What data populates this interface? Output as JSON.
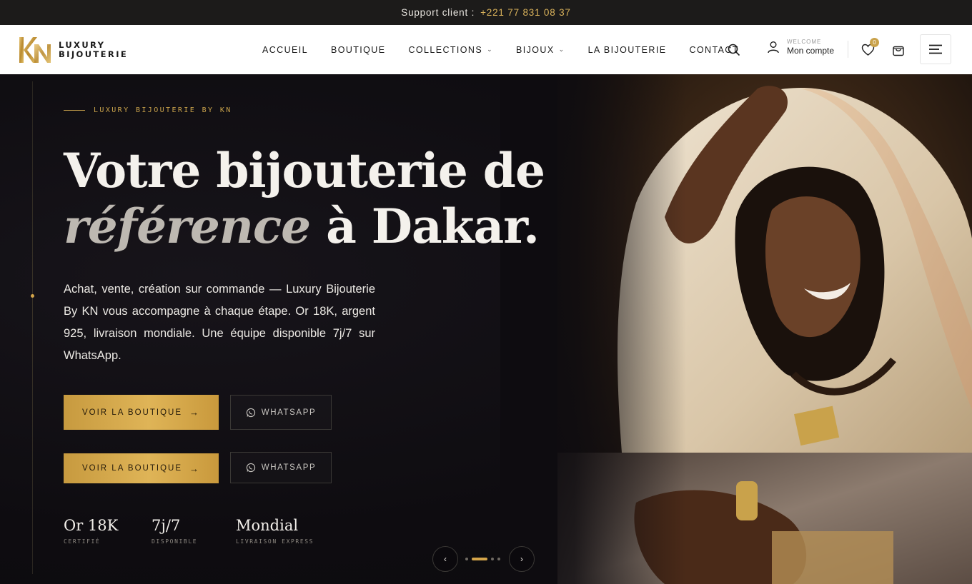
{
  "topbar": {
    "label": "Support client :",
    "phone": "+221 77 831 08 37"
  },
  "brand": {
    "mark": "KN",
    "line1": "LUXURY",
    "line2": "BIJOUTERIE",
    "gold": "#c9a24b"
  },
  "nav": {
    "items": [
      {
        "label": "ACCUEIL",
        "dropdown": false
      },
      {
        "label": "BOUTIQUE",
        "dropdown": false
      },
      {
        "label": "COLLECTIONS",
        "dropdown": true
      },
      {
        "label": "BIJOUX",
        "dropdown": true
      },
      {
        "label": "LA BIJOUTERIE",
        "dropdown": false
      },
      {
        "label": "CONTACT",
        "dropdown": false
      }
    ]
  },
  "account": {
    "welcome": "WELCOME",
    "label": "Mon compte"
  },
  "wishlist": {
    "count": "0"
  },
  "hero": {
    "eyebrow": "LUXURY BIJOUTERIE BY KN",
    "title_line1": "Votre bijouterie de",
    "title_italic": "référence",
    "title_rest": "à Dakar.",
    "description": "Achat, vente, création sur commande — Luxury Bijouterie By KN vous accompagne à chaque étape. Or 18K, argent 925, livraison mondiale. Une équipe disponible 7j/7 sur WhatsApp.",
    "primary_button": "VOIR LA BOUTIQUE",
    "secondary_button": "WHATSAPP",
    "stats": [
      {
        "value": "Or 18K",
        "label": "CERTIFIÉ"
      },
      {
        "value": "7j/7",
        "label": "DISPONIBLE"
      },
      {
        "value": "Mondial",
        "label": "LIVRAISON EXPRESS"
      }
    ],
    "carousel": {
      "slides": 4,
      "active": 2
    }
  }
}
